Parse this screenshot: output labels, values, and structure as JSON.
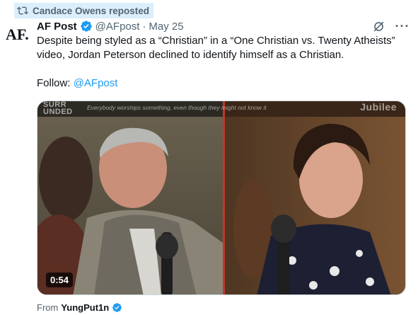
{
  "repost": {
    "label": "Candace Owens reposted",
    "icon": "repost-icon"
  },
  "avatar": {
    "text": "AF."
  },
  "author": {
    "name": "AF Post",
    "handle": "@AFpost",
    "separator": "·",
    "date": "May 25"
  },
  "tweet": {
    "text": "Despite being styled as a “Christian” in a “One Christian vs. Twenty Atheists” video, Jordan Peterson declined to identify himself as a Christian.",
    "follow_label": "Follow: ",
    "follow_link": "@AFpost"
  },
  "video": {
    "duration": "0:54",
    "caption": "Everybody worships something, even though they might not know it",
    "brand_left": "SURR\nUNDED",
    "brand_right": "Jubilee"
  },
  "from": {
    "label": "From",
    "user": "YungPut1n"
  },
  "colors": {
    "accent": "#1d9bf0",
    "muted": "#536471",
    "repost_highlight": "#dbeefb",
    "text": "#0f1419"
  }
}
